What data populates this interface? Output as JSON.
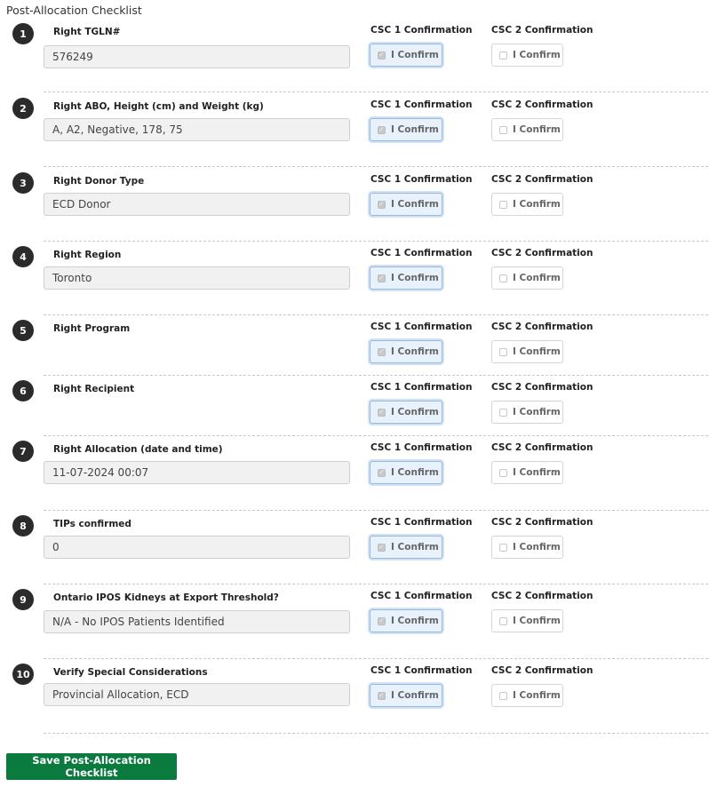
{
  "page_title": "Post-Allocation Checklist",
  "csc1_header": "CSC 1 Confirmation",
  "csc2_header": "CSC 2 Confirmation",
  "confirm_label": "I Confirm",
  "items": [
    {
      "number": "1",
      "label": "Right TGLN#",
      "value": "576249",
      "csc1_checked": true,
      "csc2_checked": false
    },
    {
      "number": "2",
      "label": "Right ABO, Height (cm) and Weight (kg)",
      "value": "A, A2, Negative, 178, 75",
      "csc1_checked": true,
      "csc2_checked": false
    },
    {
      "number": "3",
      "label": "Right Donor Type",
      "value": "ECD Donor",
      "csc1_checked": true,
      "csc2_checked": false
    },
    {
      "number": "4",
      "label": "Right Region",
      "value": "Toronto",
      "csc1_checked": true,
      "csc2_checked": false
    },
    {
      "number": "5",
      "label": "Right Program",
      "value": null,
      "csc1_checked": true,
      "csc2_checked": false
    },
    {
      "number": "6",
      "label": "Right Recipient",
      "value": null,
      "csc1_checked": true,
      "csc2_checked": false
    },
    {
      "number": "7",
      "label": "Right Allocation (date and time)",
      "value": "11-07-2024 00:07",
      "csc1_checked": true,
      "csc2_checked": false
    },
    {
      "number": "8",
      "label": "TIPs confirmed",
      "value": "0",
      "csc1_checked": true,
      "csc2_checked": false
    },
    {
      "number": "9",
      "label": "Ontario IPOS Kidneys at Export Threshold?",
      "value": "N/A - No IPOS Patients Identified",
      "csc1_checked": true,
      "csc2_checked": false
    },
    {
      "number": "10",
      "label": "Verify Special Considerations",
      "value": "Provincial Allocation, ECD",
      "csc1_checked": true,
      "csc2_checked": false
    }
  ],
  "save_button": "Save Post-Allocation Checklist",
  "colors": {
    "save_button": "#0b7a3e",
    "csc1_active_bg": "#e8f2fd"
  }
}
